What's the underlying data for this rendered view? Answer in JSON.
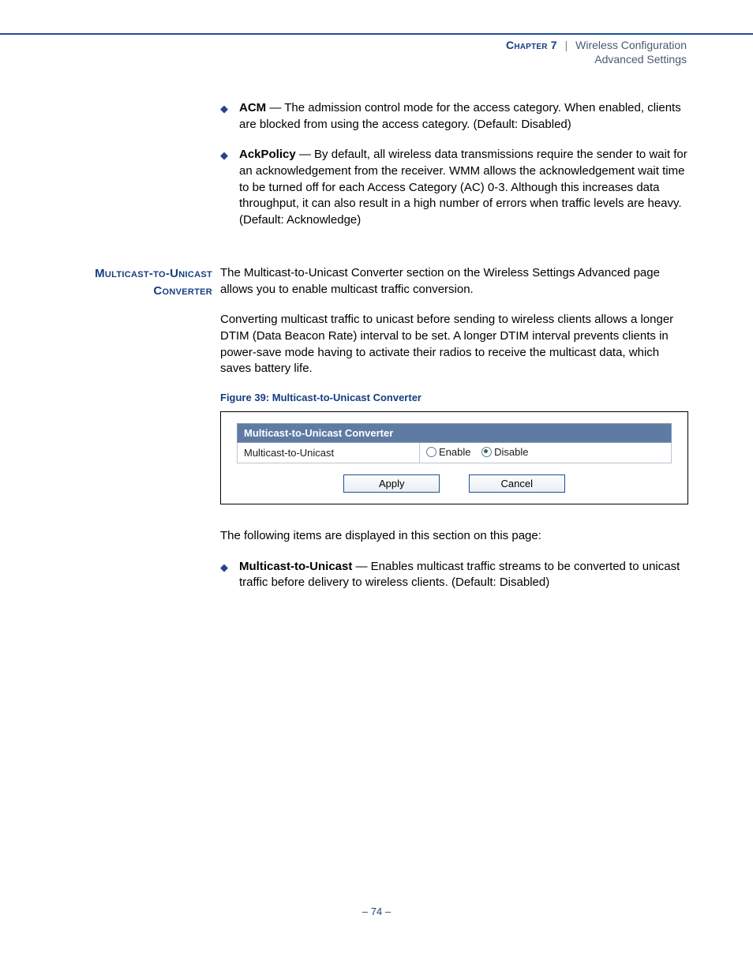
{
  "header": {
    "chapter_label": "Chapter 7",
    "separator": "|",
    "chapter_title": "Wireless Configuration",
    "section_title": "Advanced Settings"
  },
  "bullets_top": [
    {
      "term": "ACM",
      "desc": " — The admission control mode for the access category. When enabled, clients are blocked from using the access category. (Default: Disabled)"
    },
    {
      "term": "AckPolicy",
      "desc": " — By default, all wireless data transmissions require the sender to wait for an acknowledgement from the receiver. WMM allows the acknowledgement wait time to be turned off for each Access Category (AC) 0-3. Although this increases data throughput, it can also result in a high number of errors when traffic levels are heavy. (Default: Acknowledge)"
    }
  ],
  "section_heading": "Multicast-to-Unicast Converter",
  "section_intro": "The Multicast-to-Unicast Converter section on the Wireless Settings Advanced page allows you to enable multicast traffic conversion.",
  "section_para": "Converting multicast traffic to unicast before sending to wireless clients allows a longer DTIM (Data Beacon Rate) interval to be set. A longer DTIM interval prevents clients in power-save mode having to activate their radios to receive the multicast data, which saves battery life.",
  "figure": {
    "caption": "Figure 39:  Multicast-to-Unicast Converter",
    "panel_title": "Multicast-to-Unicast Converter",
    "row_label": "Multicast-to-Unicast",
    "radio_enable": "Enable",
    "radio_disable": "Disable",
    "selected": "disable",
    "apply": "Apply",
    "cancel": "Cancel"
  },
  "post_fig_para": "The following items are displayed in this section on this page:",
  "bullets_bottom": [
    {
      "term": "Multicast-to-Unicast",
      "desc": " — Enables multicast traffic streams to be converted to unicast traffic before delivery to wireless clients. (Default: Disabled)"
    }
  ],
  "footer": "–  74  –"
}
